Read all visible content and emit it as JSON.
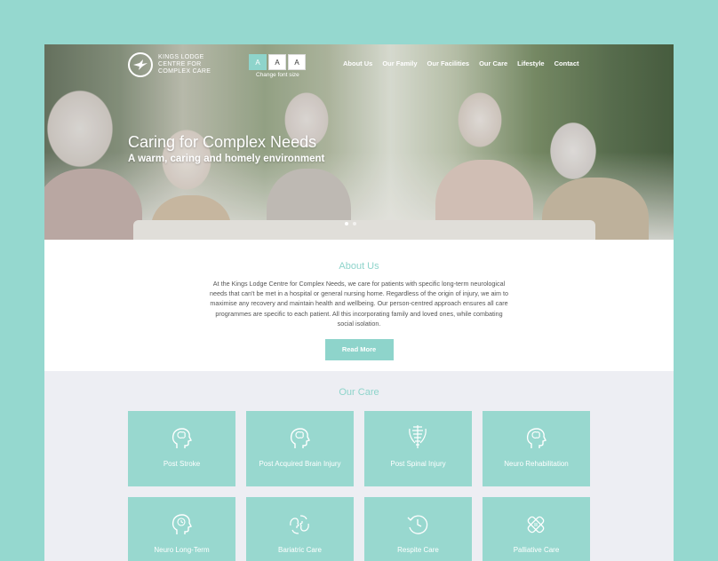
{
  "header": {
    "logo_line1": "KINGS LODGE",
    "logo_line2": "CENTRE FOR",
    "logo_line3": "COMPLEX CARE",
    "font_buttons": [
      "A",
      "A",
      "A"
    ],
    "font_label": "Change font size",
    "nav": [
      "About Us",
      "Our Family",
      "Our Facilities",
      "Our Care",
      "Lifestyle",
      "Contact"
    ]
  },
  "hero": {
    "title": "Caring for Complex Needs",
    "subtitle": "A warm, caring and homely environment"
  },
  "about": {
    "heading": "About Us",
    "body": "At the Kings Lodge Centre for Complex Needs, we care for patients with specific long-term neurological needs that can't be met in a hospital or general nursing home. Regardless of the origin of injury, we aim to maximise any recovery and maintain health and wellbeing. Our person-centred approach ensures all care programmes are specific to each patient. All this incorporating family and loved ones, while combating social isolation.",
    "button": "Read More"
  },
  "care": {
    "heading": "Our Care",
    "items": [
      {
        "label": "Post Stroke",
        "icon": "head-brain-icon"
      },
      {
        "label": "Post Acquired Brain Injury",
        "icon": "head-brain-icon"
      },
      {
        "label": "Post Spinal Injury",
        "icon": "spine-icon"
      },
      {
        "label": "Neuro Rehabilitation",
        "icon": "head-brain-icon"
      },
      {
        "label": "Neuro Long-Term",
        "icon": "head-clock-icon"
      },
      {
        "label": "Bariatric Care",
        "icon": "heads-cycle-icon"
      },
      {
        "label": "Respite Care",
        "icon": "clock-arrow-icon"
      },
      {
        "label": "Palliative Care",
        "icon": "bandage-icon"
      }
    ]
  },
  "colors": {
    "accent": "#8ed4cb",
    "background": "#95d8cf",
    "card": "#98d8cf",
    "care_bg": "#edeef3"
  }
}
